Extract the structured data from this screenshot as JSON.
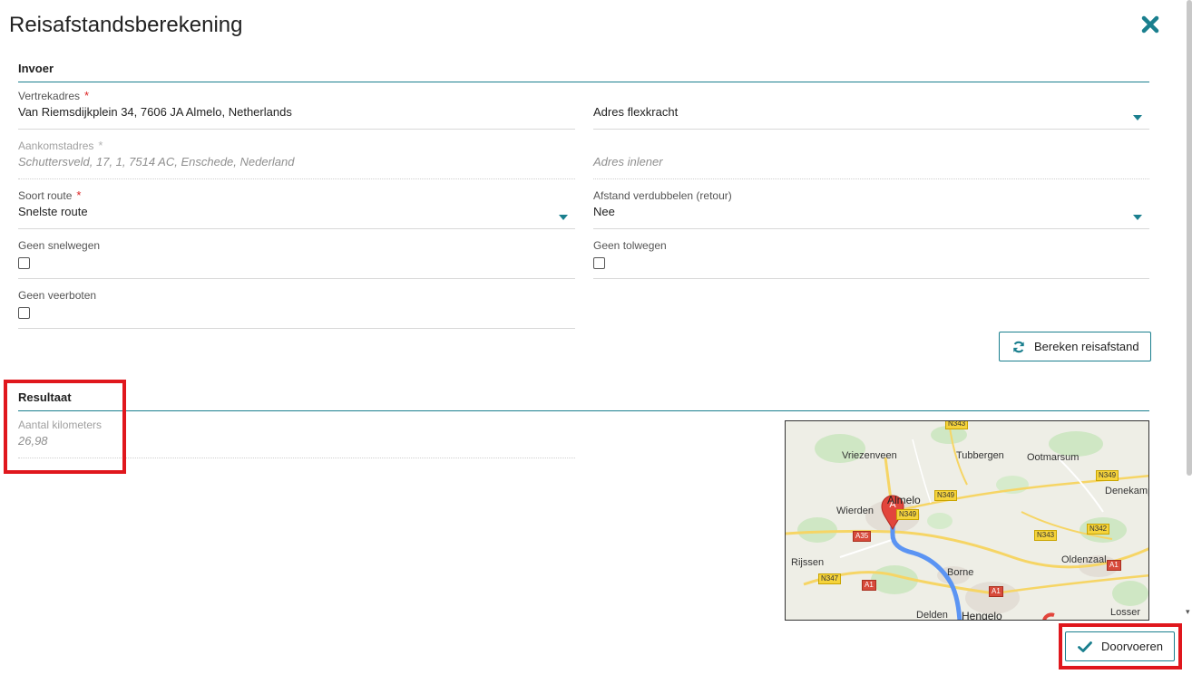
{
  "dialog": {
    "title": "Reisafstandsberekening",
    "close_icon": "close-icon"
  },
  "invoer": {
    "heading": "Invoer",
    "vertrekadres": {
      "label": "Vertrekadres",
      "required": "*",
      "value": "Van Riemsdijkplein 34, 7606 JA Almelo, Netherlands"
    },
    "adres_flexkracht": {
      "value": "Adres flexkracht"
    },
    "aankomstadres": {
      "label": "Aankomstadres",
      "required": "*",
      "value": "Schuttersveld, 17, 1, 7514 AC, Enschede, Nederland"
    },
    "adres_inlener": {
      "value": "Adres inlener"
    },
    "soort_route": {
      "label": "Soort route",
      "required": "*",
      "value": "Snelste route"
    },
    "afstand_verdubbelen": {
      "label": "Afstand verdubbelen (retour)",
      "value": "Nee"
    },
    "geen_snelwegen": {
      "label": "Geen snelwegen",
      "checked": false
    },
    "geen_tolwegen": {
      "label": "Geen tolwegen",
      "checked": false
    },
    "geen_veerboten": {
      "label": "Geen veerboten",
      "checked": false
    },
    "bereken_button": "Bereken reisafstand"
  },
  "resultaat": {
    "heading": "Resultaat",
    "aantal_kilometers": {
      "label": "Aantal kilometers",
      "value": "26,98"
    }
  },
  "map": {
    "marker_label": "A",
    "towns": [
      "Vriezenveen",
      "Tubbergen",
      "Ootmarsum",
      "Denekamp",
      "Almelo",
      "Wierden",
      "Rijssen",
      "Borne",
      "Oldenzaal",
      "Delden",
      "Hengelo",
      "Losser"
    ],
    "shields": {
      "n343_top": "N343",
      "n349_right": "N349",
      "n349_mid": "N349",
      "n349_low": "N349",
      "n343_right": "N343",
      "n342": "N342",
      "a35": "A35",
      "a1_right": "A1",
      "n347": "N347",
      "a1_left": "A1",
      "a1_mid": "A1"
    },
    "route_color": "#5b94f3",
    "marker_color": "#e2453c"
  },
  "footer": {
    "doorvoeren_button": "Doorvoeren"
  },
  "colors": {
    "accent": "#1a7f8e",
    "required": "#dd2222",
    "highlight": "#e0171d"
  }
}
